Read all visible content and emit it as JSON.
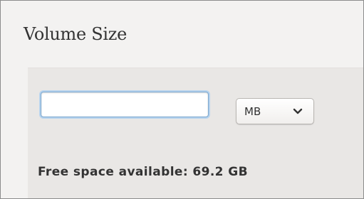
{
  "section": {
    "title": "Volume Size"
  },
  "size_input": {
    "value": "",
    "placeholder": ""
  },
  "unit_select": {
    "selected": "MB",
    "icon": "chevron-down-icon"
  },
  "free_space": {
    "text": "Free space available: 69.2 GB"
  },
  "colors": {
    "focus_ring": "#b7d3ee",
    "panel_bg": "#e9e7e5",
    "page_bg": "#f3f2f1"
  }
}
